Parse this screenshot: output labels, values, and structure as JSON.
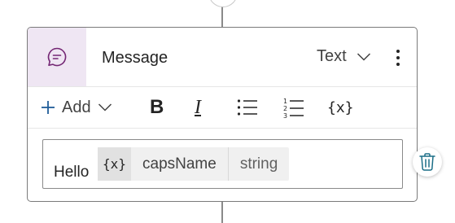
{
  "card": {
    "title": "Message",
    "type_select": {
      "value": "Text",
      "icon": "chevron-down-icon"
    }
  },
  "toolbar": {
    "add_label": "Add",
    "bold_label": "B",
    "italic_label": "I",
    "variable_label": "{x}"
  },
  "editor": {
    "text": "Hello",
    "variable": {
      "icon_text": "{x}",
      "name": "capsName",
      "type": "string"
    }
  },
  "colors": {
    "icon_tile_bg": "#efe6f3",
    "accent": "#742774",
    "delete_icon": "#1b6e87"
  }
}
